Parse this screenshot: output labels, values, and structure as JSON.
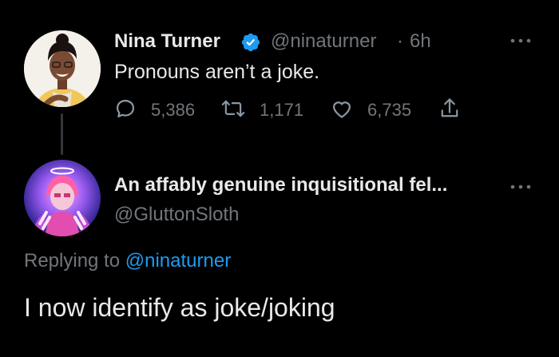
{
  "original_tweet": {
    "author_name": "Nina Turner",
    "verified": true,
    "handle": "@ninaturner",
    "separator": "·",
    "time": "6h",
    "more_icon": "more-horizontal-icon",
    "text": "Pronouns aren’t a joke.",
    "stats": {
      "replies": "5,386",
      "retweets": "1,171",
      "likes": "6,735"
    }
  },
  "reply_tweet": {
    "author_name": "An affably genuine inquisitional fel...",
    "handle": "@GluttonSloth",
    "more_icon": "more-horizontal-icon",
    "replying_prefix": "Replying to",
    "replying_to": "@ninaturner",
    "text": "I now identify as joke/joking"
  },
  "colors": {
    "background": "#000000",
    "primary_text": "#e7e9ea",
    "secondary_text": "#71767b",
    "accent": "#1d9bf0"
  }
}
